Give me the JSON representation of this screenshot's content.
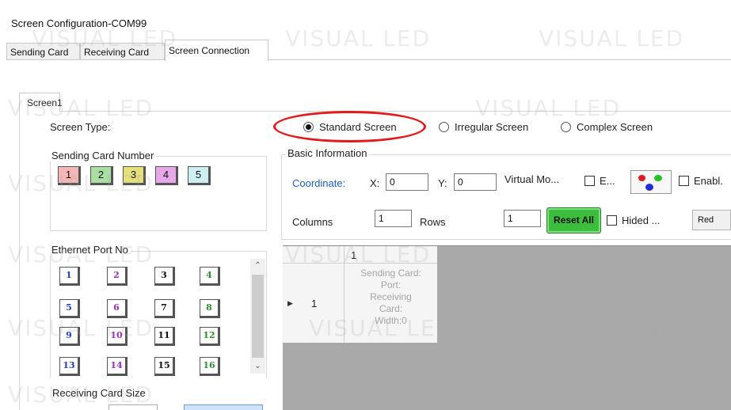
{
  "window": {
    "title": "Screen Configuration-COM99"
  },
  "main_tabs": [
    {
      "label": "Sending Card"
    },
    {
      "label": "Receiving Card"
    },
    {
      "label": "Screen Connection"
    }
  ],
  "screen_tab": "Screen1",
  "screen_type": {
    "label": "Screen Type:",
    "options": [
      "Standard Screen",
      "Irregular Screen",
      "Complex Screen"
    ],
    "selected": "Standard Screen"
  },
  "sending_card_number": {
    "title": "Sending Card Number",
    "cards": [
      {
        "label": "1",
        "color": "#f4b6b6"
      },
      {
        "label": "2",
        "color": "#a9dfa2"
      },
      {
        "label": "3",
        "color": "#e6e07a"
      },
      {
        "label": "4",
        "color": "#e6a8e8"
      },
      {
        "label": "5",
        "color": "#cdeff0"
      }
    ]
  },
  "ethernet_port": {
    "title": "Ethernet Port No",
    "ports": [
      {
        "label": "1",
        "color": "#1f3fbf"
      },
      {
        "label": "2",
        "color": "#9a2fb4"
      },
      {
        "label": "3",
        "color": "#111111"
      },
      {
        "label": "4",
        "color": "#2f8f2f"
      },
      {
        "label": "5",
        "color": "#1f3fbf"
      },
      {
        "label": "6",
        "color": "#9a2fb4"
      },
      {
        "label": "7",
        "color": "#111111"
      },
      {
        "label": "8",
        "color": "#2f8f2f"
      },
      {
        "label": "9",
        "color": "#1f3fbf"
      },
      {
        "label": "10",
        "color": "#9a2fb4"
      },
      {
        "label": "11",
        "color": "#111111"
      },
      {
        "label": "12",
        "color": "#2f8f2f"
      },
      {
        "label": "13",
        "color": "#1f3fbf"
      },
      {
        "label": "14",
        "color": "#9a2fb4"
      },
      {
        "label": "15",
        "color": "#111111"
      },
      {
        "label": "16",
        "color": "#2f8f2f"
      }
    ]
  },
  "receiving_card_size": {
    "title": "Receiving Card Size"
  },
  "basic_info": {
    "title": "Basic Information",
    "coordinate_label": "Coordinate:",
    "x_label": "X:",
    "x_value": "0",
    "y_label": "Y:",
    "y_value": "0",
    "virtual_label": "Virtual Mo...",
    "e_label": "E...",
    "enable_label": "Enabl.",
    "columns_label": "Columns",
    "columns_value": "1",
    "rows_label": "Rows",
    "rows_value": "1",
    "reset_label": "Reset All",
    "hided_label": "Hided ...",
    "color_select": "Red"
  },
  "grid": {
    "col_header": "1",
    "row_header": "1",
    "cell_lines": [
      "Sending Card:",
      "Port:",
      "Receiving",
      "Card:",
      "Width:0"
    ]
  },
  "watermark": "VISUAL LED"
}
